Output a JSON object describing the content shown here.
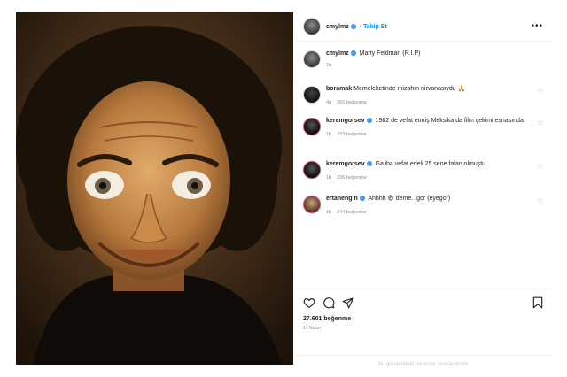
{
  "post": {
    "author": "cmylmz",
    "follow_label": "Takip Et",
    "more_icon": "more-horizontal-icon",
    "caption": "Marty Feldman (R.I.P)",
    "caption_time": "1h",
    "likes": "27.601 beğenme",
    "date": "13 Nisan",
    "limited_notice": "Bu gönderideki yorumlar sınırlandırıldı."
  },
  "comments": [
    {
      "user": "boramak",
      "verified": false,
      "text": "Memeleketinde mizahın nirvanasıydı. 🙏",
      "time": "4g",
      "likes": "260 beğenme"
    },
    {
      "user": "keremgorsev",
      "verified": true,
      "text": "1982 de vefat etmiş Meksika da film çekimi esnasında.",
      "time": "1h",
      "likes": "333 beğenme"
    },
    {
      "user": "keremgorsev",
      "verified": true,
      "text": "Galiba vefat edeli 25 sene falan olmuştu.",
      "time": "1h",
      "likes": "336 beğenme"
    },
    {
      "user": "ertanengin",
      "verified": true,
      "text": "Ahhhh 😄 deme. Igor (eyegor)",
      "time": "1h",
      "likes": "244 beğenme"
    }
  ],
  "colors": {
    "accent": "#0095f6",
    "verified": "#3897f0"
  }
}
